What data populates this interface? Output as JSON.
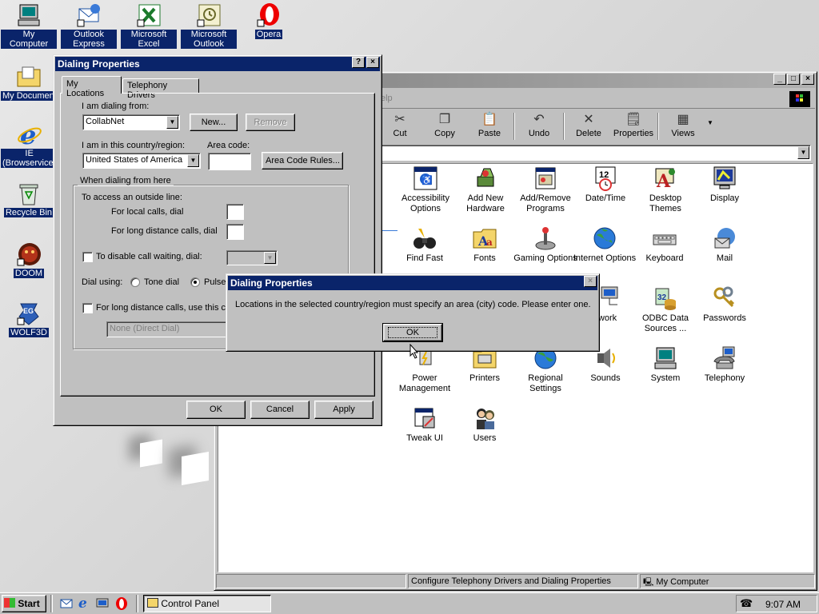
{
  "desktop": {
    "icons": [
      {
        "label": "My Computer",
        "icon": "computer-icon"
      },
      {
        "label": "Outlook Express",
        "icon": "outlook-express-icon"
      },
      {
        "label": "Microsoft Excel",
        "icon": "excel-icon"
      },
      {
        "label": "Microsoft Outlook",
        "icon": "outlook-icon"
      },
      {
        "label": "Opera",
        "icon": "opera-icon"
      },
      {
        "label": "My Documents",
        "icon": "folder-icon"
      },
      {
        "label": "IE (Browservice)",
        "icon": "ie-icon"
      },
      {
        "label": "Recycle Bin",
        "icon": "recycle-bin-icon"
      },
      {
        "label": "DOOM",
        "icon": "doom-icon"
      },
      {
        "label": "WOLF3D",
        "icon": "wolf3d-icon"
      }
    ]
  },
  "control_panel": {
    "menu_partial": "elp",
    "toolbar": [
      {
        "label": "Cut",
        "icon": "scissors-icon"
      },
      {
        "label": "Copy",
        "icon": "copy-icon"
      },
      {
        "label": "Paste",
        "icon": "paste-icon"
      },
      {
        "label": "Undo",
        "icon": "undo-icon"
      },
      {
        "label": "Delete",
        "icon": "delete-icon"
      },
      {
        "label": "Properties",
        "icon": "properties-icon"
      },
      {
        "label": "Views",
        "icon": "views-icon"
      }
    ],
    "items": [
      "Accessibility Options",
      "Add New Hardware",
      "Add/Remove Programs",
      "Date/Time",
      "Desktop Themes",
      "Display",
      "Find Fast",
      "Fonts",
      "Gaming Options",
      "Internet Options",
      "Keyboard",
      "Mail",
      "",
      "",
      "",
      "twork",
      "ODBC Data Sources ...",
      "Passwords",
      "",
      "Power Management",
      "Printers",
      "Regional Settings",
      "Sounds",
      "System",
      "Telephony",
      "Tweak UI",
      "Users"
    ],
    "status_left": "Configure Telephony Drivers and Dialing Properties",
    "status_right": "My Computer"
  },
  "dialing": {
    "title": "Dialing Properties",
    "tabs": [
      "My Locations",
      "Telephony Drivers"
    ],
    "dialing_from_label": "I am dialing from:",
    "location_value": "CollabNet",
    "new_btn": "New...",
    "remove_btn": "Remove",
    "country_label": "I am in this country/region:",
    "country_value": "United States of America",
    "area_code_label": "Area code:",
    "area_code_value": "",
    "area_rules_btn": "Area Code Rules...",
    "group_label": "When dialing from here",
    "outside_line": "To access an outside line:",
    "local_label": "For local calls, dial",
    "long_label": "For long distance calls, dial",
    "disable_wait": "To disable call waiting, dial:",
    "dial_using": "Dial using:",
    "tone": "Tone dial",
    "pulse": "Pulse",
    "long_distance_card": "For long distance calls, use this ca",
    "card_value": "None (Direct Dial)",
    "ok": "OK",
    "cancel": "Cancel",
    "apply": "Apply"
  },
  "alert": {
    "title": "Dialing Properties",
    "message": "Locations in the selected country/region must specify an area (city) code. Please enter one.",
    "ok": "OK"
  },
  "taskbar": {
    "start": "Start",
    "task": "Control Panel",
    "time": "9:07 AM"
  }
}
